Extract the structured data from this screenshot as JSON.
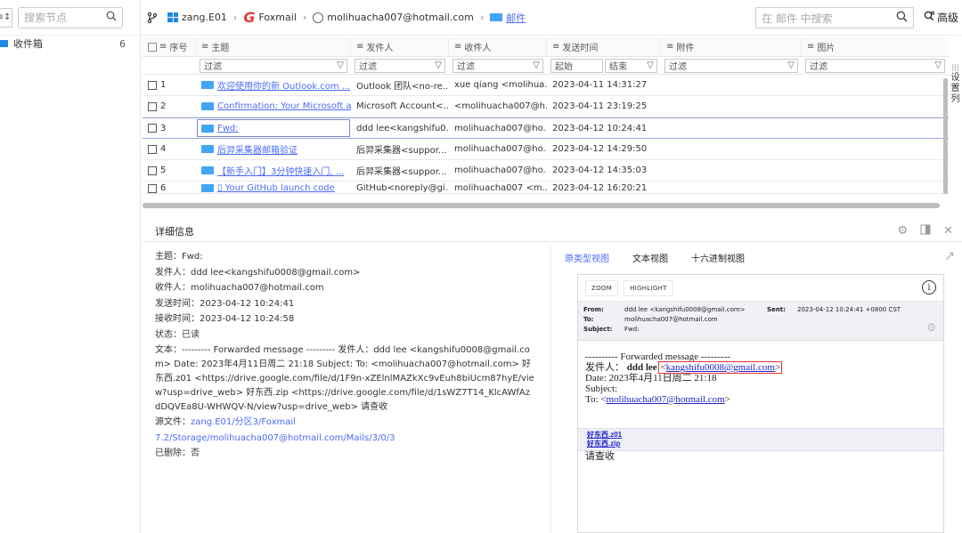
{
  "sidebar": {
    "sort_glyph": "≡↕",
    "search_placeholder": "搜索节点",
    "tree": [
      {
        "label": "收件箱",
        "count": "6"
      }
    ]
  },
  "topbar": {
    "breadcrumb": {
      "device": "zang.E01",
      "app": "Foxmail",
      "account": "molihuacha007@hotmail.com",
      "folder": "邮件"
    },
    "search_placeholder": "在 邮件 中搜索",
    "advanced_label": "高级"
  },
  "table": {
    "headers": {
      "seq": "序号",
      "subject": "主题",
      "from": "发件人",
      "to": "收件人",
      "time": "发送时间",
      "attachment": "附件",
      "image": "图片"
    },
    "filter_placeholder": "过滤",
    "time_start": "起始",
    "time_end": "结束",
    "rows": [
      {
        "seq": "1",
        "subject": "欢迎使用你的新 Outlook.com ...",
        "from": "Outlook 团队<no-re...",
        "to": "xue qiang <molihua...",
        "time": "2023-04-11 14:31:27"
      },
      {
        "seq": "2",
        "subject": "Confirmation: Your Microsoft a...",
        "from": "Microsoft Account<...",
        "to": "<molihuacha007@h...",
        "time": "2023-04-11 23:19:25"
      },
      {
        "seq": "3",
        "subject": "Fwd:",
        "from": "ddd lee<kangshifu0...",
        "to": "molihuacha007@ho...",
        "time": "2023-04-12 10:24:41"
      },
      {
        "seq": "4",
        "subject": "后羿采集器邮箱验证",
        "from": "后羿采集器<suppor...",
        "to": "molihuacha007@ho...",
        "time": "2023-04-12 14:29:50"
      },
      {
        "seq": "5",
        "subject": "【新手入门】3分钟快速入门, ...",
        "from": "后羿采集器<suppor...",
        "to": "molihuacha007@ho...",
        "time": "2023-04-12 14:35:03"
      },
      {
        "seq": "6",
        "subject": "▯ Your GitHub launch code",
        "from": "GitHub<noreply@gi...",
        "to": "molihuacha007 <m...",
        "time": "2023-04-12 16:20:21"
      }
    ],
    "selected_index": 2,
    "side_settings": [
      "设",
      "置",
      "列"
    ]
  },
  "detail": {
    "title": "详细信息",
    "fields": {
      "subject": "主题：Fwd:",
      "from": "发件人：ddd lee<kangshifu0008@gmail.com>",
      "to": "收件人：molihuacha007@hotmail.com",
      "sent": "发送时间：2023-04-12 10:24:41",
      "received": "接收时间：2023-04-12 10:24:58",
      "status": "状态：已读",
      "body_label": "文本：",
      "body_text": "--------- Forwarded message --------- 发件人：ddd lee <kangshifu0008@gmail.com> Date: 2023年4月11日周二 21:18 Subject: To: <molihuacha007@hotmail.com> 好东西.z01 <https://drive.google.com/file/d/1F9n-xZElnlMAZkXc9vEuh8biUcm87hyE/view?usp=drive_web> 好东西.zip <https://drive.google.com/file/d/1sWZ7T14_KlcAWfAzdDQVEa8U-WHWQV-N/view?usp=drive_web> 请查收",
      "source_label": "源文件：",
      "source_path": "zang.E01/分区3/Foxmail 7.2/Storage/molihuacha007@hotmail.com/Mails/3/0/3",
      "deleted": "已删除：否"
    },
    "view_tabs": [
      "原类型视图",
      "文本视图",
      "十六进制视图"
    ],
    "active_view": 0,
    "mail_view": {
      "zoom_label": "ZOOM",
      "highlight_label": "HIGHLIGHT",
      "from_key": "From:",
      "from_val": "ddd lee <kangshifu0008@gmail.com>",
      "to_key": "To:",
      "to_val": "molihuacha007@hotmail.com",
      "subject_key": "Subject:",
      "subject_val": "Fwd:",
      "sent_key": "Sent:",
      "sent_val": "2023-04-12 10:24:41 +0800 CST",
      "body_forward": "---------- Forwarded message ---------",
      "body_from_label": "发件人：",
      "body_from_name": "ddd lee",
      "body_from_email": "kangshifu0008@gmail.com",
      "body_date": "Date: 2023年4月11日周二 21:18",
      "body_subject": "Subject:",
      "body_to_label": "To: ",
      "body_to_email": "molihuacha007@hotmail.com",
      "attachments": [
        "好东西.z01",
        "好东西.zip"
      ],
      "closing": "请查收"
    }
  }
}
